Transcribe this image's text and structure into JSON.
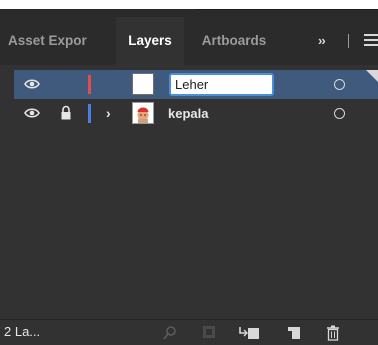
{
  "tabs": [
    {
      "label": "Asset Expor"
    },
    {
      "label": "Layers",
      "active": true
    },
    {
      "label": "Artboards"
    }
  ],
  "overflow_label": "››",
  "layers": [
    {
      "name": "Leher",
      "color": "#e24c4c",
      "editing": true,
      "selected": true,
      "locked": false,
      "expandable": false
    },
    {
      "name": "kepala",
      "color": "#4c7fe2",
      "editing": false,
      "selected": false,
      "locked": true,
      "expandable": true
    }
  ],
  "footer": {
    "layer_count": "2 La..."
  },
  "icons": {
    "visibility": "eye-icon",
    "lock": "lock-icon",
    "expand": "chevron-right-icon",
    "target": "target-circle-icon",
    "menu": "hamburger-menu-icon",
    "search": "search-icon",
    "clipping": "clipping-mask-icon",
    "sublayer": "new-sublayer-icon",
    "new_layer": "new-layer-icon",
    "delete": "trash-icon"
  },
  "colors": {
    "panel_bg": "#323232",
    "selected_row": "#3f5a7d",
    "input_border": "#4a90d9"
  }
}
